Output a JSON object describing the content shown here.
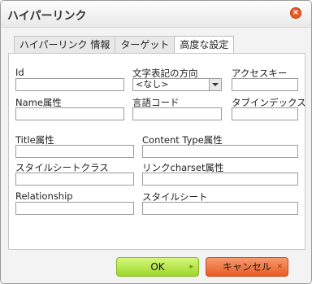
{
  "dialog": {
    "title": "ハイパーリンク",
    "close_icon": "×"
  },
  "tabs": [
    {
      "label": "ハイパーリンク 情報"
    },
    {
      "label": "ターゲット"
    },
    {
      "label": "高度な設定"
    }
  ],
  "fields": {
    "id": {
      "label": "Id",
      "value": ""
    },
    "text_direction": {
      "label": "文字表記の方向",
      "value": "<なし>"
    },
    "access_key": {
      "label": "アクセスキー",
      "value": ""
    },
    "name": {
      "label": "Name属性",
      "value": ""
    },
    "lang_code": {
      "label": "言語コード",
      "value": ""
    },
    "tab_index": {
      "label": "タブインデックス",
      "value": ""
    },
    "title": {
      "label": "Title属性",
      "value": ""
    },
    "content_type": {
      "label": "Content Type属性",
      "value": ""
    },
    "stylesheet_classes": {
      "label": "スタイルシートクラス",
      "value": ""
    },
    "charset": {
      "label": "リンクcharset属性",
      "value": ""
    },
    "relationship": {
      "label": "Relationship",
      "value": ""
    },
    "style": {
      "label": "スタイルシート",
      "value": ""
    }
  },
  "buttons": {
    "ok": {
      "label": "OK",
      "icon": "▸"
    },
    "cancel": {
      "label": "キャンセル",
      "icon": "✕"
    }
  },
  "colors": {
    "ok": "#9fd62c",
    "cancel": "#e95b24"
  }
}
